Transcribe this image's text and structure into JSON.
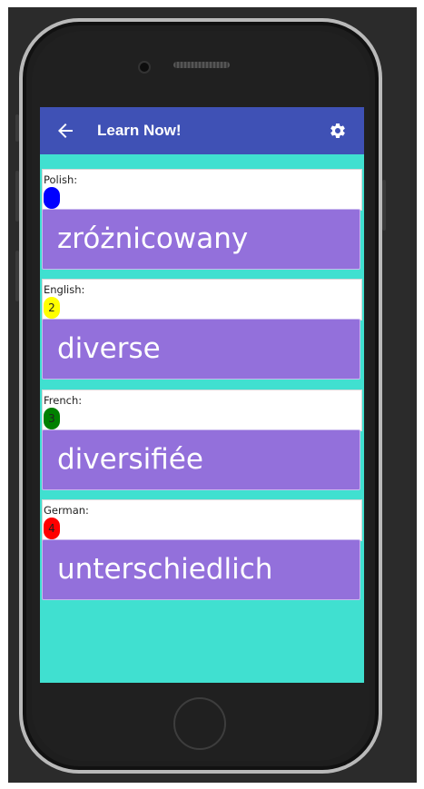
{
  "appbar": {
    "title": "Learn Now!",
    "color": "#3f51b5",
    "back_icon": "arrow-left-icon",
    "settings_icon": "gear-icon"
  },
  "screen_background": "#40e0d0",
  "cards": [
    {
      "language": "Polish:",
      "badge": "",
      "badge_color": "#0000ff",
      "word": "zróżnicowany"
    },
    {
      "language": "English:",
      "badge": "2",
      "badge_color": "#ffff00",
      "word": "diverse"
    },
    {
      "language": "French:",
      "badge": "3",
      "badge_color": "#008000",
      "word": "diversifiée"
    },
    {
      "language": "German:",
      "badge": "4",
      "badge_color": "#ff0000",
      "word": "unterschiedlich"
    }
  ],
  "word_background": "#9370db"
}
